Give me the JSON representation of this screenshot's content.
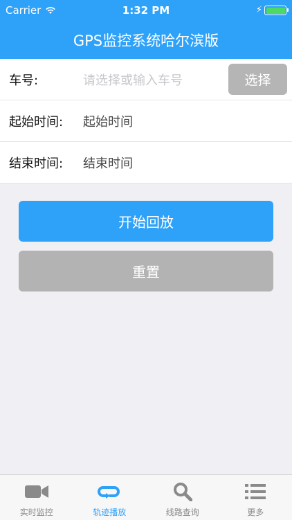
{
  "status_bar": {
    "carrier": "Carrier",
    "time": "1:32 PM"
  },
  "nav": {
    "title": "GPS监控系统哈尔滨版"
  },
  "form": {
    "vehicle": {
      "label": "车号:",
      "placeholder": "请选择或输入车号",
      "button": "选择"
    },
    "start_time": {
      "label": "起始时间:",
      "value": "起始时间"
    },
    "end_time": {
      "label": "结束时间:",
      "value": "结束时间"
    }
  },
  "actions": {
    "start_playback": "开始回放",
    "reset": "重置"
  },
  "tabs": [
    {
      "label": "实时监控",
      "icon": "video-camera-icon"
    },
    {
      "label": "轨迹播放",
      "icon": "replay-loop-icon",
      "active": true
    },
    {
      "label": "线路查询",
      "icon": "search-icon"
    },
    {
      "label": "更多",
      "icon": "list-icon"
    }
  ],
  "colors": {
    "accent": "#2ea1f8",
    "button_gray": "#b3b3b3",
    "battery": "#4cd964"
  }
}
